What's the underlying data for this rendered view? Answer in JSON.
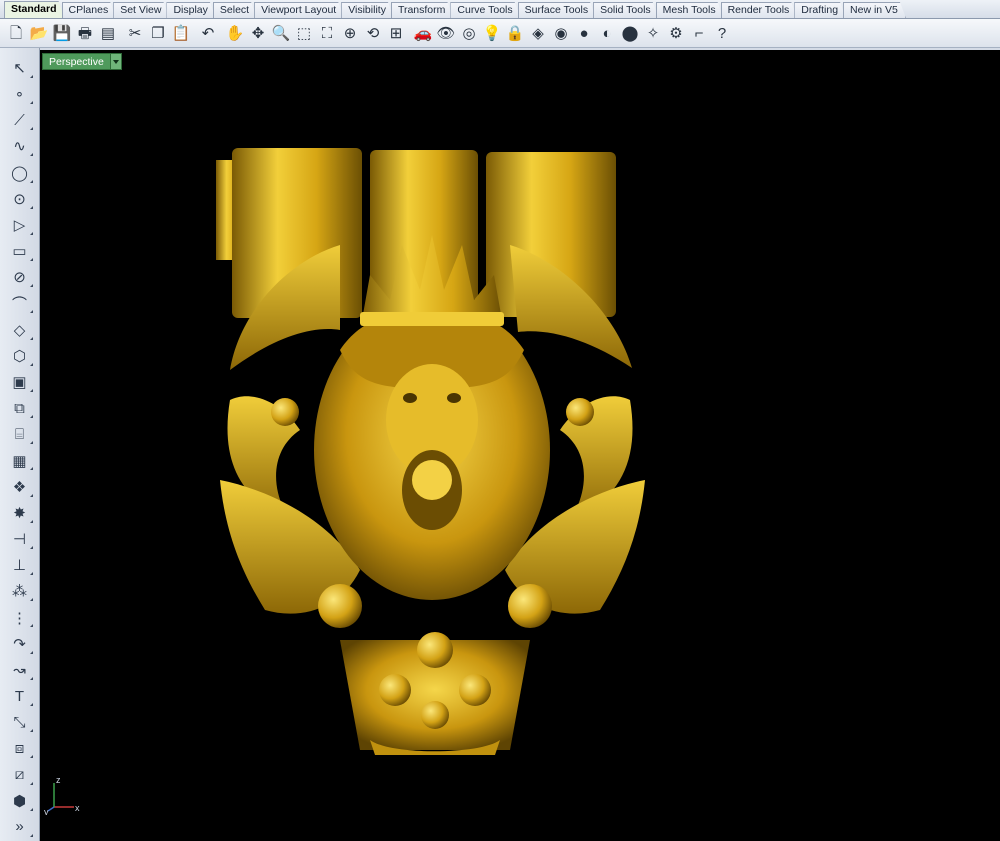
{
  "tabs": [
    {
      "label": "Standard",
      "active": true
    },
    {
      "label": "CPlanes"
    },
    {
      "label": "Set View"
    },
    {
      "label": "Display"
    },
    {
      "label": "Select"
    },
    {
      "label": "Viewport Layout"
    },
    {
      "label": "Visibility"
    },
    {
      "label": "Transform"
    },
    {
      "label": "Curve Tools"
    },
    {
      "label": "Surface Tools"
    },
    {
      "label": "Solid Tools"
    },
    {
      "label": "Mesh Tools"
    },
    {
      "label": "Render Tools"
    },
    {
      "label": "Drafting"
    },
    {
      "label": "New in V5"
    }
  ],
  "toolbar_icons": [
    {
      "name": "new-file-icon",
      "glyph": "🗋"
    },
    {
      "name": "open-folder-icon",
      "glyph": "📂"
    },
    {
      "name": "save-icon",
      "glyph": "💾"
    },
    {
      "name": "print-icon",
      "glyph": "🖶"
    },
    {
      "name": "layer-sheet-icon",
      "glyph": "▤"
    },
    {
      "name": "cut-icon",
      "glyph": "✂"
    },
    {
      "name": "copy-icon",
      "glyph": "❐"
    },
    {
      "name": "paste-icon",
      "glyph": "📋"
    },
    {
      "name": "undo-icon",
      "glyph": "↶"
    },
    {
      "name": "pan-hand-icon",
      "glyph": "✋"
    },
    {
      "name": "move-view-icon",
      "glyph": "✥"
    },
    {
      "name": "zoom-icon",
      "glyph": "🔍"
    },
    {
      "name": "zoom-window-icon",
      "glyph": "⬚"
    },
    {
      "name": "zoom-extents-icon",
      "glyph": "⛶"
    },
    {
      "name": "zoom-selected-icon",
      "glyph": "⊕"
    },
    {
      "name": "rotate-view-icon",
      "glyph": "⟲"
    },
    {
      "name": "four-viewports-icon",
      "glyph": "⊞"
    },
    {
      "name": "car-icon",
      "glyph": "🚗"
    },
    {
      "name": "hide-objects-icon",
      "glyph": "👁"
    },
    {
      "name": "snap-icon",
      "glyph": "◎"
    },
    {
      "name": "lightbulb-icon",
      "glyph": "💡"
    },
    {
      "name": "lock-icon",
      "glyph": "🔒"
    },
    {
      "name": "layers-icon",
      "glyph": "◈"
    },
    {
      "name": "color-wheel-icon",
      "glyph": "◉"
    },
    {
      "name": "shaded-sphere-icon",
      "glyph": "●"
    },
    {
      "name": "wire-sphere-icon",
      "glyph": "◐"
    },
    {
      "name": "render-sphere-icon",
      "glyph": "⬤"
    },
    {
      "name": "light-icon",
      "glyph": "✧"
    },
    {
      "name": "settings-gear-icon",
      "glyph": "⚙"
    },
    {
      "name": "grid-snap-icon",
      "glyph": "⌐"
    },
    {
      "name": "help-icon",
      "glyph": "?"
    }
  ],
  "sidebar_icons": [
    {
      "name": "select-arrow-icon",
      "glyph": "↖"
    },
    {
      "name": "point-icon",
      "glyph": "∘"
    },
    {
      "name": "polyline-icon",
      "glyph": "⟋"
    },
    {
      "name": "curve-icon",
      "glyph": "∿"
    },
    {
      "name": "circle-icon",
      "glyph": "◯"
    },
    {
      "name": "ellipse-icon",
      "glyph": "⊙"
    },
    {
      "name": "polygon-icon",
      "glyph": "▷"
    },
    {
      "name": "rectangle-icon",
      "glyph": "▭"
    },
    {
      "name": "curve-from-object-icon",
      "glyph": "⊘"
    },
    {
      "name": "fillet-curve-icon",
      "glyph": "⌒"
    },
    {
      "name": "surface-corner-icon",
      "glyph": "◇"
    },
    {
      "name": "extrude-surface-icon",
      "glyph": "⬡"
    },
    {
      "name": "box-solid-icon",
      "glyph": "▣"
    },
    {
      "name": "boolean-icon",
      "glyph": "⧉"
    },
    {
      "name": "cylinder-icon",
      "glyph": "⌸"
    },
    {
      "name": "mesh-icon",
      "glyph": "▦"
    },
    {
      "name": "transform-gear-icon",
      "glyph": "❖"
    },
    {
      "name": "explode-icon",
      "glyph": "✸"
    },
    {
      "name": "trim-icon",
      "glyph": "⊣"
    },
    {
      "name": "split-icon",
      "glyph": "⊥"
    },
    {
      "name": "group-icon",
      "glyph": "⁂"
    },
    {
      "name": "array-icon",
      "glyph": "⋮"
    },
    {
      "name": "rotate-icon",
      "glyph": "↷"
    },
    {
      "name": "move-icon",
      "glyph": "↝"
    },
    {
      "name": "text-icon",
      "glyph": "T"
    },
    {
      "name": "dimension-icon",
      "glyph": "⤡"
    },
    {
      "name": "block-icon",
      "glyph": "⧈"
    },
    {
      "name": "analyze-icon",
      "glyph": "⧄"
    },
    {
      "name": "render-box-icon",
      "glyph": "⬢"
    },
    {
      "name": "more-tools-icon",
      "glyph": "»"
    }
  ],
  "viewport": {
    "label": "Perspective",
    "background": "#000000",
    "axis_labels": {
      "x": "x",
      "y": "y",
      "z": "z"
    }
  },
  "colors": {
    "gold": "#e2b319",
    "gold_dark": "#7a5a05",
    "viewport_tab_bg": "#4f9a5c"
  }
}
